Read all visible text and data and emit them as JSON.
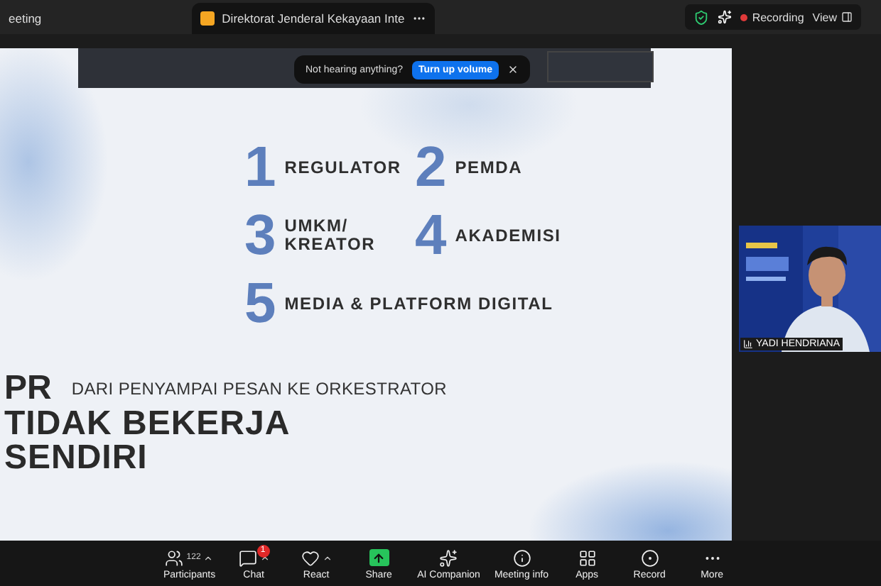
{
  "top_bar": {
    "tabs": [
      {
        "label": "eeting",
        "selected": false
      },
      {
        "label": "Direktorat Jenderal Kekayaan Inte",
        "selected": true
      }
    ],
    "recording": "Recording",
    "view": "View"
  },
  "toast": {
    "message": "Not hearing anything?",
    "button": "Turn up volume"
  },
  "slide": {
    "items": [
      {
        "number": "1",
        "label": "REGULATOR"
      },
      {
        "number": "2",
        "label": "PEMDA"
      },
      {
        "number": "3",
        "label": "UMKM/\nKREATOR"
      },
      {
        "number": "4",
        "label": "AKADEMISI"
      },
      {
        "number": "5",
        "label": "MEDIA & PLATFORM DIGITAL"
      }
    ],
    "title": "PR",
    "subtitle": "DARI PENYAMPAI PESAN KE ORKESTRATOR",
    "headline": [
      "TIDAK BEKERJA",
      "SENDIRI"
    ]
  },
  "video": {
    "name": "YADI HENDRIANA"
  },
  "toolbar": [
    {
      "kind": "participants",
      "label": "Participants",
      "count": "122",
      "caret": true
    },
    {
      "kind": "chat",
      "label": "Chat",
      "badge": "1",
      "caret": true
    },
    {
      "kind": "react",
      "label": "React",
      "caret": true
    },
    {
      "kind": "share",
      "label": "Share",
      "caret": false
    },
    {
      "kind": "ai",
      "label": "AI Companion",
      "caret": false
    },
    {
      "kind": "info",
      "label": "Meeting info",
      "caret": false
    },
    {
      "kind": "apps",
      "label": "Apps",
      "caret": false
    },
    {
      "kind": "record",
      "label": "Record",
      "caret": false
    },
    {
      "kind": "more",
      "label": "More",
      "caret": false
    }
  ]
}
